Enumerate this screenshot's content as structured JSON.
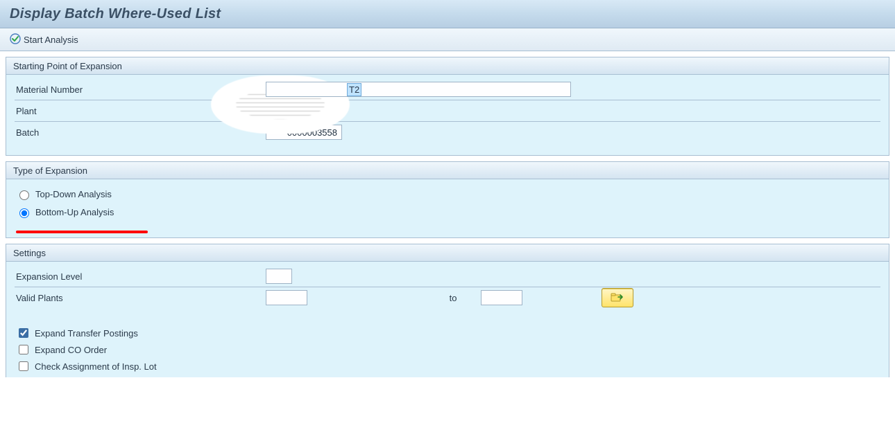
{
  "title": "Display Batch Where-Used List",
  "toolbar": {
    "start_analysis_label": "Start Analysis"
  },
  "groups": {
    "starting_point": {
      "title": "Starting Point of Expansion",
      "material_label": "Material Number",
      "material_value_visible": "T2",
      "plant_label": "Plant",
      "plant_value": "",
      "batch_label": "Batch",
      "batch_value": "0000003558"
    },
    "expansion_type": {
      "title": "Type of Expansion",
      "options": [
        {
          "id": "top_down",
          "label": "Top-Down Analysis",
          "selected": false
        },
        {
          "id": "bottom_up",
          "label": "Bottom-Up Analysis",
          "selected": true
        }
      ]
    },
    "settings": {
      "title": "Settings",
      "expansion_level_label": "Expansion Level",
      "expansion_level_value": "",
      "valid_plants_label": "Valid Plants",
      "valid_plants_from": "",
      "to_label": "to",
      "valid_plants_to": "",
      "checks": [
        {
          "id": "expand_transfer",
          "label": "Expand Transfer Postings",
          "checked": true
        },
        {
          "id": "expand_co",
          "label": "Expand CO Order",
          "checked": false
        },
        {
          "id": "check_insp_lot",
          "label": "Check Assignment of Insp. Lot",
          "checked": false
        }
      ]
    }
  },
  "icons": {
    "start_analysis": "execute-icon",
    "multiple_selection": "folder-arrow-icon"
  }
}
